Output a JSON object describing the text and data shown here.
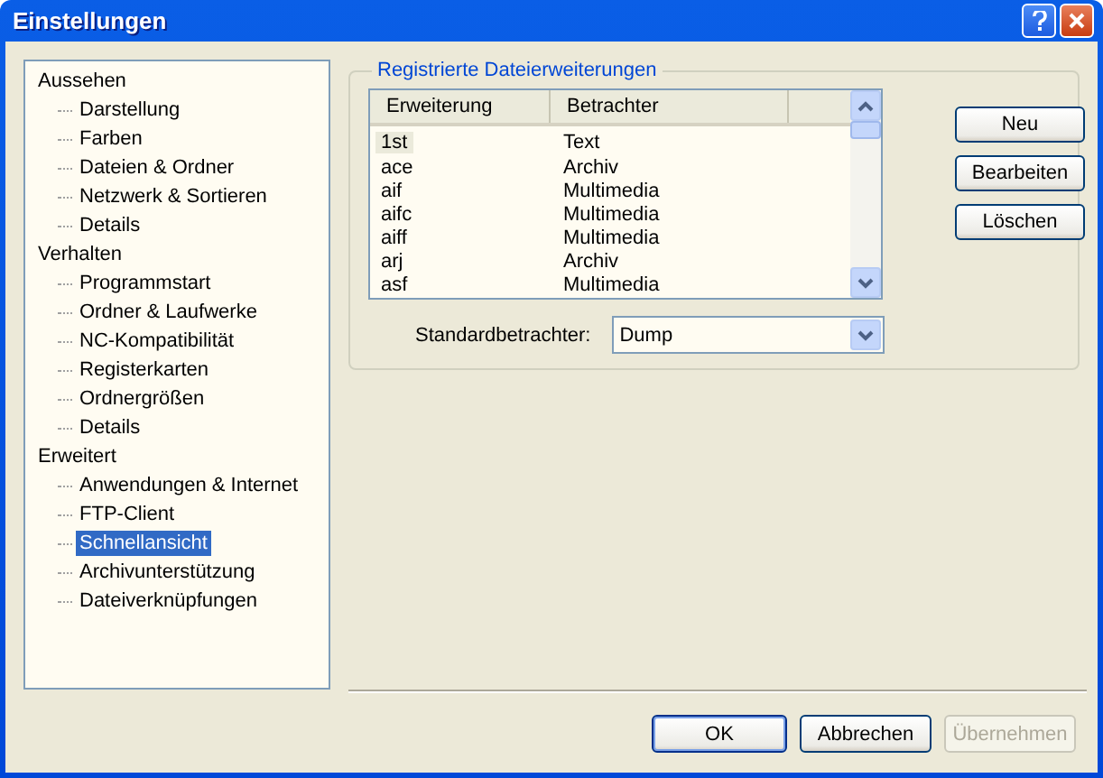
{
  "window": {
    "title": "Einstellungen"
  },
  "tree": [
    {
      "label": "Aussehen",
      "selected": false,
      "children": [
        {
          "label": "Darstellung",
          "selected": false
        },
        {
          "label": "Farben",
          "selected": false
        },
        {
          "label": "Dateien & Ordner",
          "selected": false
        },
        {
          "label": "Netzwerk & Sortieren",
          "selected": false
        },
        {
          "label": "Details",
          "selected": false
        }
      ]
    },
    {
      "label": "Verhalten",
      "selected": false,
      "children": [
        {
          "label": "Programmstart",
          "selected": false
        },
        {
          "label": "Ordner & Laufwerke",
          "selected": false
        },
        {
          "label": "NC-Kompatibilität",
          "selected": false
        },
        {
          "label": "Registerkarten",
          "selected": false
        },
        {
          "label": "Ordnergrößen",
          "selected": false
        },
        {
          "label": "Details",
          "selected": false
        }
      ]
    },
    {
      "label": "Erweitert",
      "selected": false,
      "children": [
        {
          "label": "Anwendungen & Internet",
          "selected": false
        },
        {
          "label": "FTP-Client",
          "selected": false
        },
        {
          "label": "Schnellansicht",
          "selected": true
        },
        {
          "label": "Archivunterstützung",
          "selected": false
        },
        {
          "label": "Dateiverknüpfungen",
          "selected": false
        }
      ]
    }
  ],
  "group": {
    "title": "Registrierte Dateierweiterungen",
    "columns": [
      "Erweiterung",
      "Betrachter"
    ],
    "rows": [
      {
        "extension": "1st",
        "viewer": "Text",
        "selected": true
      },
      {
        "extension": "ace",
        "viewer": "Archiv",
        "selected": false
      },
      {
        "extension": "aif",
        "viewer": "Multimedia",
        "selected": false
      },
      {
        "extension": "aifc",
        "viewer": "Multimedia",
        "selected": false
      },
      {
        "extension": "aiff",
        "viewer": "Multimedia",
        "selected": false
      },
      {
        "extension": "arj",
        "viewer": "Archiv",
        "selected": false
      },
      {
        "extension": "asf",
        "viewer": "Multimedia",
        "selected": false
      }
    ],
    "default_viewer": {
      "label": "Standardbetrachter:",
      "value": "Dump"
    },
    "buttons": [
      "Neu",
      "Bearbeiten",
      "Löschen"
    ]
  },
  "footer_buttons": [
    {
      "label": "OK",
      "default": true,
      "disabled": false
    },
    {
      "label": "Abbrechen",
      "default": false,
      "disabled": false
    },
    {
      "label": "Übernehmen",
      "default": false,
      "disabled": true
    }
  ]
}
